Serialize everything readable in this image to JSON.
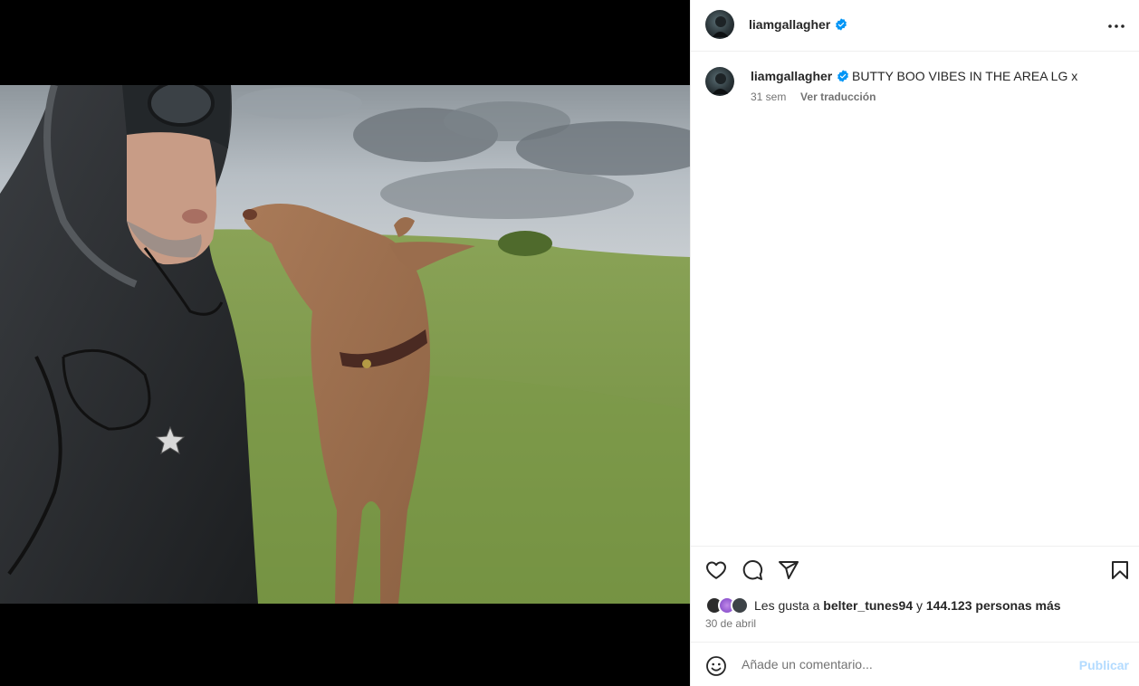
{
  "post": {
    "username": "liamgallagher",
    "caption": "BUTTY BOO VIBES IN THE AREA LG x",
    "time_ago": "31 sem",
    "translate_label": "Ver traducción",
    "likes_prefix": "Les gusta a",
    "liked_by_user": "belter_tunes94",
    "likes_connector": "y",
    "likes_rest": "144.123 personas más",
    "date": "30 de abril"
  },
  "icons": {
    "more": "more-options-icon",
    "like": "heart-icon",
    "comment": "comment-icon",
    "share": "paper-plane-icon",
    "save": "bookmark-icon",
    "emoji": "emoji-icon",
    "verified": "verified-badge-icon"
  },
  "comment": {
    "placeholder": "Añade un comentario...",
    "publish_label": "Publicar"
  },
  "colors": {
    "verified": "#0095f6",
    "publish_disabled": "#b3dbff",
    "secondary_text": "#737373"
  }
}
